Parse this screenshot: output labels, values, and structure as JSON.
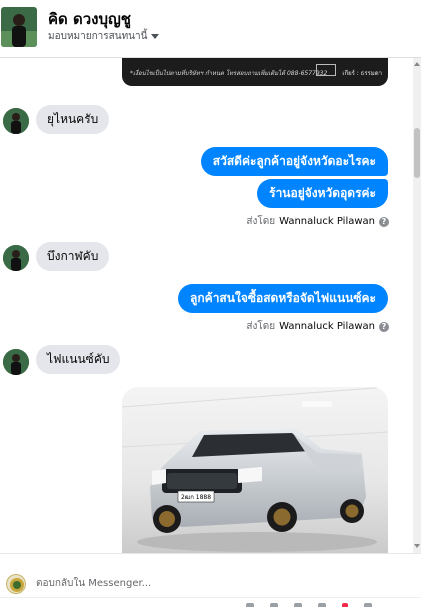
{
  "header": {
    "contact_name": "คิด ดวงบุญชู",
    "assign_label": "มอบหมายการสนทนานี้"
  },
  "banner": {
    "caption": "*เงื่อนไขเป็นไปตามที่บริษัทฯ กำหนด โทรสอบถามเพิ่มเติมได้ 088-6577932",
    "brand": "เกียร์ : ธรรมดา"
  },
  "messages": [
    {
      "direction": "in",
      "text": "ยุไหนครับ"
    },
    {
      "direction": "out",
      "text": "สวัสดีค่ะลูกค้าอยู่จังหวัดอะไรคะ"
    },
    {
      "direction": "out",
      "text": "ร้านอยู่จังหวัดอุดรค่ะ"
    },
    {
      "direction": "in",
      "text": "บึงกาฬคับ"
    },
    {
      "direction": "out",
      "text": "ลูกค้าสนใจซื้อสดหรือจัดไฟแนนซ์คะ"
    },
    {
      "direction": "in",
      "text": "ไฟแนนซ์คับ"
    }
  ],
  "sent_by": {
    "prefix": "ส่งโดย",
    "name": "Wannaluck Pilawan",
    "help_glyph": "?"
  },
  "photo": {
    "plate_text": "2ฒก 1888",
    "icon": "pickup-truck-photo"
  },
  "composer": {
    "placeholder": "ตอบกลับใน Messenger..."
  }
}
